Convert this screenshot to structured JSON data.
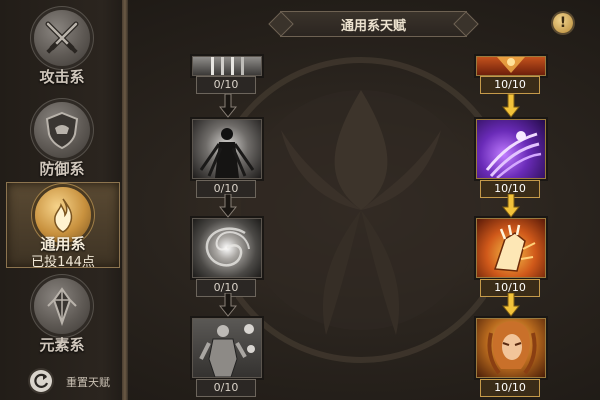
{
  "header": {
    "title": "通用系天赋",
    "info_symbol": "!"
  },
  "sidebar": {
    "categories": [
      {
        "label": "攻击系",
        "icon": "crossed-swords-icon",
        "sub": ""
      },
      {
        "label": "防御系",
        "icon": "shield-icon",
        "sub": ""
      },
      {
        "label": "通用系",
        "icon": "flame-icon",
        "sub": "已投144点"
      },
      {
        "label": "元素系",
        "icon": "crystal-icon",
        "sub": ""
      }
    ],
    "active_index": 2,
    "reset_label": "重置天赋"
  },
  "talents": {
    "left": [
      {
        "count": "0/10",
        "icon": "dark-bars-icon"
      },
      {
        "count": "0/10",
        "icon": "shadow-figure-icon"
      },
      {
        "count": "0/10",
        "icon": "vortex-icon"
      },
      {
        "count": "0/10",
        "icon": "armored-warrior-icon"
      }
    ],
    "right": [
      {
        "count": "10/10",
        "icon": "fire-emblem-icon"
      },
      {
        "count": "10/10",
        "icon": "purple-claw-icon"
      },
      {
        "count": "10/10",
        "icon": "flaming-gauntlet-icon"
      },
      {
        "count": "10/10",
        "icon": "golden-warrior-icon"
      }
    ]
  },
  "colors": {
    "accent_gold": "#c59a4a",
    "arrow_gold": "#f2c23a",
    "arrow_dark": "#1a1612",
    "active_tab": "#5a4a33"
  }
}
